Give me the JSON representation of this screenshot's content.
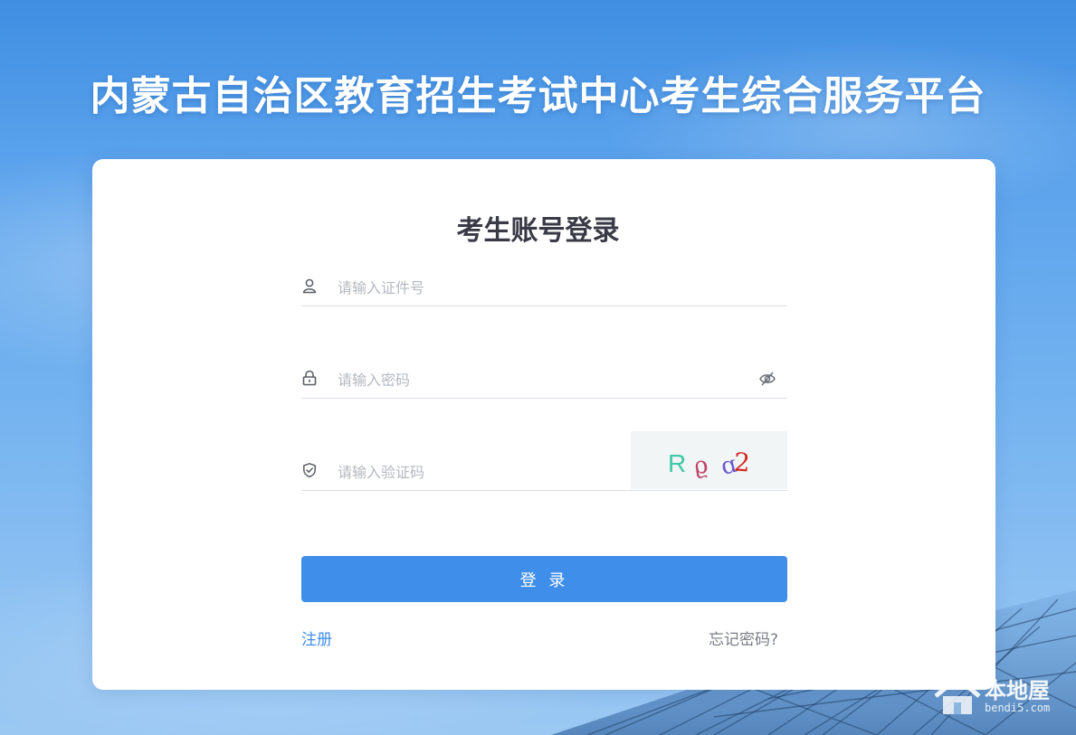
{
  "header": {
    "title": "内蒙古自治区教育招生考试中心考生综合服务平台"
  },
  "login": {
    "title": "考生账号登录",
    "id_field": {
      "placeholder": "请输入证件号",
      "value": "",
      "icon": "user-icon"
    },
    "password_field": {
      "placeholder": "请输入密码",
      "value": "",
      "icon": "lock-icon",
      "toggle_icon": "eye-off-icon"
    },
    "captcha_field": {
      "placeholder": "请输入验证码",
      "value": "",
      "icon": "shield-check-icon"
    },
    "captcha_chars": [
      "R",
      "ϱ",
      "ɑ",
      "2"
    ],
    "captcha_colors": [
      "#3ec9a7",
      "#c0446a",
      "#6a5acd",
      "#d0281e"
    ],
    "submit_label": "登 录",
    "register_link": "注册",
    "forgot_link": "忘记密码?"
  },
  "watermark": {
    "brand": "本地屋",
    "domain": "bendi5.com"
  },
  "colors": {
    "accent": "#3f8ee9",
    "title_text": "#3a3a46"
  }
}
